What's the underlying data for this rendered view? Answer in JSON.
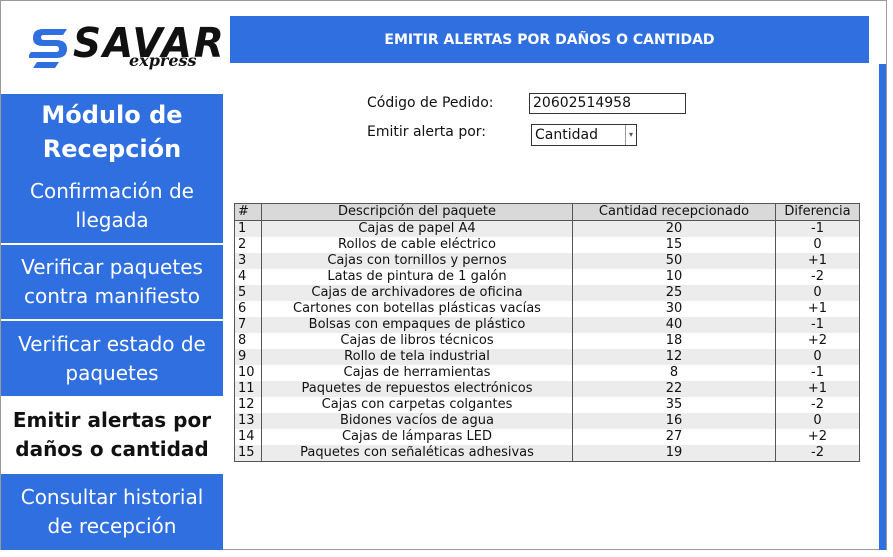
{
  "logo": {
    "name": "SAVAR",
    "tagline": "express"
  },
  "sidebar": {
    "module_title": "Módulo de Recepción",
    "items": [
      {
        "label": "Confirmación de llegada",
        "active": false
      },
      {
        "label": "Verificar paquetes contra manifiesto",
        "active": false
      },
      {
        "label": "Verificar estado de paquetes",
        "active": false
      },
      {
        "label": "Emitir alertas por daños o cantidad",
        "active": true
      },
      {
        "label": "Consultar historial de recepción",
        "active": false
      }
    ]
  },
  "header": {
    "title": "EMITIR ALERTAS POR DAÑOS O CANTIDAD"
  },
  "form": {
    "order_code_label": "Código de Pedido:",
    "order_code_value": "20602514958",
    "alert_by_label": "Emitir alerta por:",
    "alert_by_value": "Cantidad"
  },
  "table": {
    "columns": [
      "#",
      "Descripción del paquete",
      "Cantidad recepcionado",
      "Diferencia"
    ],
    "rows": [
      [
        "1",
        "Cajas de papel A4",
        "20",
        "-1"
      ],
      [
        "2",
        "Rollos de cable eléctrico",
        "15",
        "0"
      ],
      [
        "3",
        "Cajas con tornillos y pernos",
        "50",
        "+1"
      ],
      [
        "4",
        "Latas de pintura de 1 galón",
        "10",
        "-2"
      ],
      [
        "5",
        "Cajas de archivadores de oficina",
        "25",
        "0"
      ],
      [
        "6",
        "Cartones con botellas plásticas vacías",
        "30",
        "+1"
      ],
      [
        "7",
        "Bolsas con empaques de plástico",
        "40",
        "-1"
      ],
      [
        "8",
        "Cajas de libros técnicos",
        "18",
        "+2"
      ],
      [
        "9",
        "Rollo de tela industrial",
        "12",
        "0"
      ],
      [
        "10",
        "Cajas de herramientas",
        "8",
        "-1"
      ],
      [
        "11",
        "Paquetes de repuestos electrónicos",
        "22",
        "+1"
      ],
      [
        "12",
        "Cajas con carpetas colgantes",
        "35",
        "-2"
      ],
      [
        "13",
        "Bidones vacíos de agua",
        "16",
        "0"
      ],
      [
        "14",
        "Cajas de lámparas LED",
        "27",
        "+2"
      ],
      [
        "15",
        "Paquetes con señaléticas adhesivas",
        "19",
        "-2"
      ]
    ]
  },
  "colors": {
    "accent": "#2f6fe0",
    "row_alt": "#ececec",
    "header_bg": "#d9d9d9"
  }
}
